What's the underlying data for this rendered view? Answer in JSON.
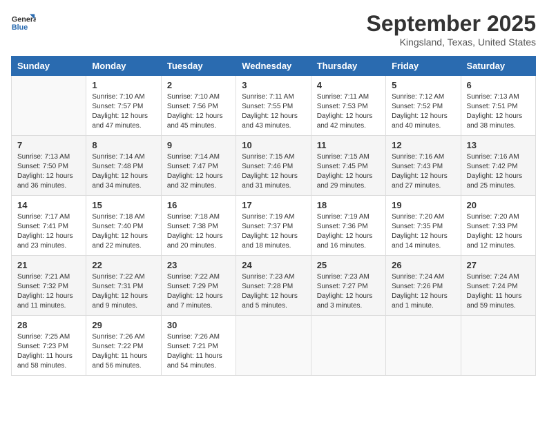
{
  "header": {
    "logo_line1": "General",
    "logo_line2": "Blue",
    "month": "September 2025",
    "location": "Kingsland, Texas, United States"
  },
  "days_of_week": [
    "Sunday",
    "Monday",
    "Tuesday",
    "Wednesday",
    "Thursday",
    "Friday",
    "Saturday"
  ],
  "weeks": [
    [
      {
        "day": "",
        "info": ""
      },
      {
        "day": "1",
        "info": "Sunrise: 7:10 AM\nSunset: 7:57 PM\nDaylight: 12 hours\nand 47 minutes."
      },
      {
        "day": "2",
        "info": "Sunrise: 7:10 AM\nSunset: 7:56 PM\nDaylight: 12 hours\nand 45 minutes."
      },
      {
        "day": "3",
        "info": "Sunrise: 7:11 AM\nSunset: 7:55 PM\nDaylight: 12 hours\nand 43 minutes."
      },
      {
        "day": "4",
        "info": "Sunrise: 7:11 AM\nSunset: 7:53 PM\nDaylight: 12 hours\nand 42 minutes."
      },
      {
        "day": "5",
        "info": "Sunrise: 7:12 AM\nSunset: 7:52 PM\nDaylight: 12 hours\nand 40 minutes."
      },
      {
        "day": "6",
        "info": "Sunrise: 7:13 AM\nSunset: 7:51 PM\nDaylight: 12 hours\nand 38 minutes."
      }
    ],
    [
      {
        "day": "7",
        "info": "Sunrise: 7:13 AM\nSunset: 7:50 PM\nDaylight: 12 hours\nand 36 minutes."
      },
      {
        "day": "8",
        "info": "Sunrise: 7:14 AM\nSunset: 7:48 PM\nDaylight: 12 hours\nand 34 minutes."
      },
      {
        "day": "9",
        "info": "Sunrise: 7:14 AM\nSunset: 7:47 PM\nDaylight: 12 hours\nand 32 minutes."
      },
      {
        "day": "10",
        "info": "Sunrise: 7:15 AM\nSunset: 7:46 PM\nDaylight: 12 hours\nand 31 minutes."
      },
      {
        "day": "11",
        "info": "Sunrise: 7:15 AM\nSunset: 7:45 PM\nDaylight: 12 hours\nand 29 minutes."
      },
      {
        "day": "12",
        "info": "Sunrise: 7:16 AM\nSunset: 7:43 PM\nDaylight: 12 hours\nand 27 minutes."
      },
      {
        "day": "13",
        "info": "Sunrise: 7:16 AM\nSunset: 7:42 PM\nDaylight: 12 hours\nand 25 minutes."
      }
    ],
    [
      {
        "day": "14",
        "info": "Sunrise: 7:17 AM\nSunset: 7:41 PM\nDaylight: 12 hours\nand 23 minutes."
      },
      {
        "day": "15",
        "info": "Sunrise: 7:18 AM\nSunset: 7:40 PM\nDaylight: 12 hours\nand 22 minutes."
      },
      {
        "day": "16",
        "info": "Sunrise: 7:18 AM\nSunset: 7:38 PM\nDaylight: 12 hours\nand 20 minutes."
      },
      {
        "day": "17",
        "info": "Sunrise: 7:19 AM\nSunset: 7:37 PM\nDaylight: 12 hours\nand 18 minutes."
      },
      {
        "day": "18",
        "info": "Sunrise: 7:19 AM\nSunset: 7:36 PM\nDaylight: 12 hours\nand 16 minutes."
      },
      {
        "day": "19",
        "info": "Sunrise: 7:20 AM\nSunset: 7:35 PM\nDaylight: 12 hours\nand 14 minutes."
      },
      {
        "day": "20",
        "info": "Sunrise: 7:20 AM\nSunset: 7:33 PM\nDaylight: 12 hours\nand 12 minutes."
      }
    ],
    [
      {
        "day": "21",
        "info": "Sunrise: 7:21 AM\nSunset: 7:32 PM\nDaylight: 12 hours\nand 11 minutes."
      },
      {
        "day": "22",
        "info": "Sunrise: 7:22 AM\nSunset: 7:31 PM\nDaylight: 12 hours\nand 9 minutes."
      },
      {
        "day": "23",
        "info": "Sunrise: 7:22 AM\nSunset: 7:29 PM\nDaylight: 12 hours\nand 7 minutes."
      },
      {
        "day": "24",
        "info": "Sunrise: 7:23 AM\nSunset: 7:28 PM\nDaylight: 12 hours\nand 5 minutes."
      },
      {
        "day": "25",
        "info": "Sunrise: 7:23 AM\nSunset: 7:27 PM\nDaylight: 12 hours\nand 3 minutes."
      },
      {
        "day": "26",
        "info": "Sunrise: 7:24 AM\nSunset: 7:26 PM\nDaylight: 12 hours\nand 1 minute."
      },
      {
        "day": "27",
        "info": "Sunrise: 7:24 AM\nSunset: 7:24 PM\nDaylight: 11 hours\nand 59 minutes."
      }
    ],
    [
      {
        "day": "28",
        "info": "Sunrise: 7:25 AM\nSunset: 7:23 PM\nDaylight: 11 hours\nand 58 minutes."
      },
      {
        "day": "29",
        "info": "Sunrise: 7:26 AM\nSunset: 7:22 PM\nDaylight: 11 hours\nand 56 minutes."
      },
      {
        "day": "30",
        "info": "Sunrise: 7:26 AM\nSunset: 7:21 PM\nDaylight: 11 hours\nand 54 minutes."
      },
      {
        "day": "",
        "info": ""
      },
      {
        "day": "",
        "info": ""
      },
      {
        "day": "",
        "info": ""
      },
      {
        "day": "",
        "info": ""
      }
    ]
  ]
}
